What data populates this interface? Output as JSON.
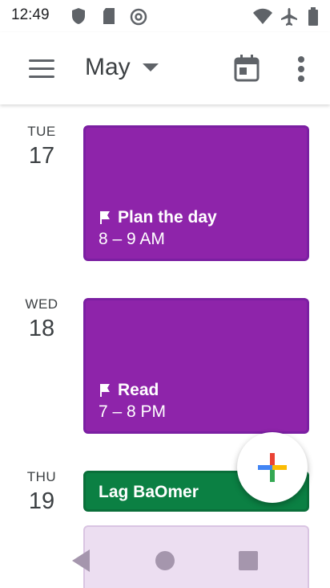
{
  "status_bar": {
    "time": "12:49",
    "icons": [
      "shield-icon",
      "sd-card-icon",
      "at-sign-icon",
      "wifi-icon",
      "airplane-mode-icon",
      "battery-icon"
    ]
  },
  "app_bar": {
    "menu_icon": "hamburger-menu-icon",
    "month_label": "May",
    "month_chevron": "caret-down-icon",
    "today_icon": "calendar-today-icon",
    "overflow_icon": "more-vertical-icon"
  },
  "days": [
    {
      "dow": "TUE",
      "date": "17",
      "events": [
        {
          "title": "Plan the day",
          "time": "8 – 9 AM",
          "color": "#8e24aa",
          "icon": "flag-icon"
        }
      ]
    },
    {
      "dow": "WED",
      "date": "18",
      "events": [
        {
          "title": "Read",
          "time": "7 – 8 PM",
          "color": "#8e24aa",
          "icon": "flag-icon"
        }
      ]
    },
    {
      "dow": "THU",
      "date": "19",
      "events": [
        {
          "title": "Lag BaOmer",
          "color": "#0b8043"
        }
      ]
    }
  ],
  "fab": {
    "icon": "plus-icon",
    "colors": [
      "#4285f4",
      "#ea4335",
      "#fbbc04",
      "#34a853"
    ]
  },
  "nav_bar": {
    "icons": [
      "back-triangle-icon",
      "home-circle-icon",
      "recents-square-icon"
    ]
  },
  "colors": {
    "accent_purple": "#8e24aa",
    "holiday_green": "#0b8043",
    "icon_gray": "#5f6368"
  }
}
